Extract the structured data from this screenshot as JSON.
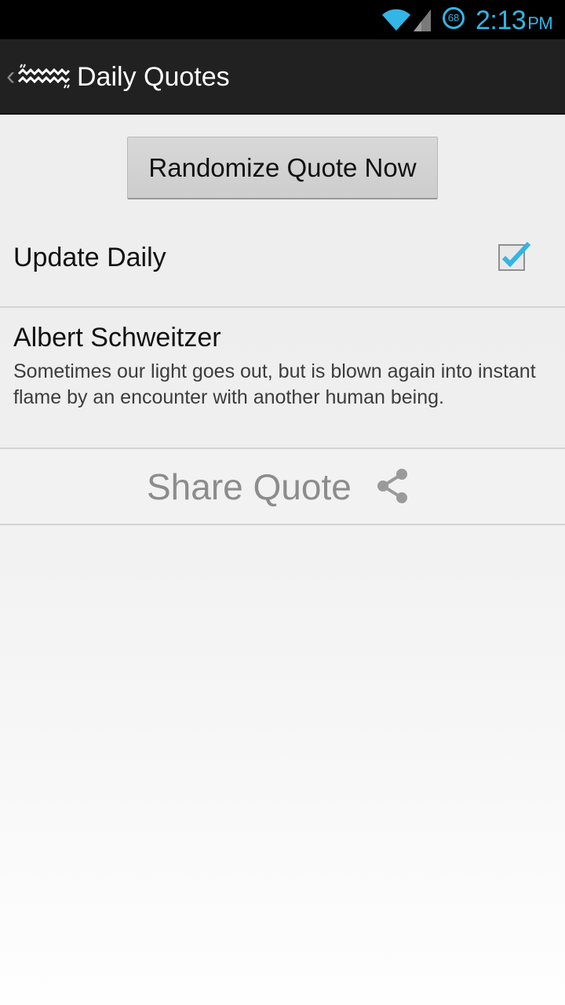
{
  "status_bar": {
    "battery_level": "68",
    "time": "2:13",
    "ampm": "PM",
    "accent_color": "#33b5e5",
    "icons": [
      "wifi-icon",
      "cell-signal-icon",
      "battery-icon"
    ]
  },
  "action_bar": {
    "title": "Daily Quotes",
    "icons": [
      "up-caret-icon",
      "app-logo-icon"
    ]
  },
  "main": {
    "randomize_label": "Randomize Quote Now",
    "update_daily_label": "Update Daily",
    "update_daily_checked": true,
    "quote_author": "Albert Schweitzer",
    "quote_text": "Sometimes our light goes out, but is blown again into instant flame by an encounter with another human being.",
    "share_label": "Share Quote",
    "share_icon": "share-icon"
  }
}
